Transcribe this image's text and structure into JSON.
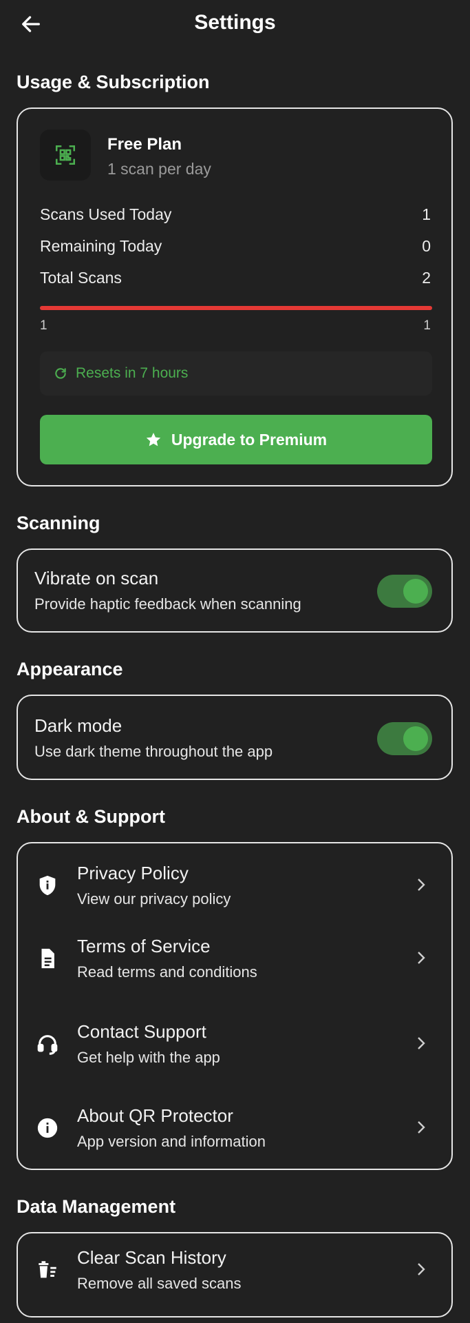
{
  "header": {
    "title": "Settings"
  },
  "usage": {
    "section_title": "Usage & Subscription",
    "plan_name": "Free Plan",
    "plan_desc": "1 scan per day",
    "stats": [
      {
        "label": "Scans Used Today",
        "value": "1"
      },
      {
        "label": "Remaining Today",
        "value": "0"
      },
      {
        "label": "Total Scans",
        "value": "2"
      }
    ],
    "progress": {
      "fraction": 1.0,
      "min_label": "1",
      "max_label": "1",
      "color": "#e53935"
    },
    "reset_text": "Resets in 7 hours",
    "upgrade_label": "Upgrade to Premium"
  },
  "scanning": {
    "section_title": "Scanning",
    "vibrate": {
      "title": "Vibrate on scan",
      "desc": "Provide haptic feedback when scanning",
      "enabled": true
    }
  },
  "appearance": {
    "section_title": "Appearance",
    "dark_mode": {
      "title": "Dark mode",
      "desc": "Use dark theme throughout the app",
      "enabled": true
    }
  },
  "about": {
    "section_title": "About & Support",
    "items": [
      {
        "icon": "shield-icon",
        "title": "Privacy Policy",
        "desc": "View our privacy policy"
      },
      {
        "icon": "document-icon",
        "title": "Terms of Service",
        "desc": "Read terms and conditions"
      },
      {
        "icon": "support-agent-icon",
        "title": "Contact Support",
        "desc": "Get help with the app"
      },
      {
        "icon": "info-icon",
        "title": "About QR Protector",
        "desc": "App version and information"
      }
    ]
  },
  "data_management": {
    "section_title": "Data Management",
    "items": [
      {
        "icon": "trash-icon",
        "title": "Clear Scan History",
        "desc": "Remove all saved scans"
      }
    ]
  },
  "colors": {
    "background": "#212121",
    "accent": "#4caf50",
    "danger": "#e53935"
  }
}
